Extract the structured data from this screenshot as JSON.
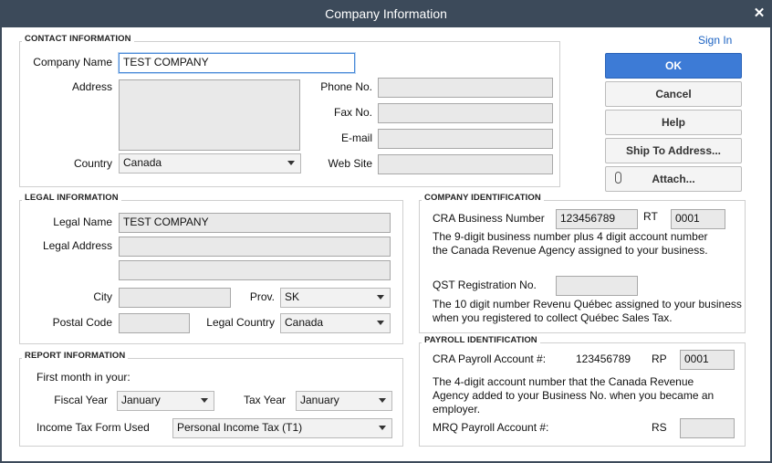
{
  "window": {
    "title": "Company Information",
    "close_glyph": "✕"
  },
  "signin": "Sign In",
  "buttons": {
    "ok": "OK",
    "cancel": "Cancel",
    "help": "Help",
    "ship_to": "Ship To Address...",
    "attach": "Attach..."
  },
  "contact": {
    "section_title": "CONTACT INFORMATION",
    "company_name_label": "Company Name",
    "company_name_value": "TEST COMPANY",
    "address_label": "Address",
    "address_value": "",
    "country_label": "Country",
    "country_value": "Canada",
    "phone_label": "Phone No.",
    "phone_value": "",
    "fax_label": "Fax No.",
    "fax_value": "",
    "email_label": "E-mail",
    "email_value": "",
    "web_label": "Web Site",
    "web_value": ""
  },
  "legal": {
    "section_title": "LEGAL INFORMATION",
    "name_label": "Legal Name",
    "name_value": "TEST COMPANY",
    "address_label": "Legal Address",
    "address_line1": "",
    "address_line2": "",
    "city_label": "City",
    "city_value": "",
    "prov_label": "Prov.",
    "prov_value": "SK",
    "postal_label": "Postal Code",
    "postal_value": "",
    "country_label": "Legal Country",
    "country_value": "Canada"
  },
  "report": {
    "section_title": "REPORT INFORMATION",
    "first_month_label": "First month in your:",
    "fiscal_label": "Fiscal Year",
    "fiscal_value": "January",
    "tax_label": "Tax Year",
    "tax_value": "January",
    "form_label": "Income Tax Form Used",
    "form_value": "Personal Income Tax (T1)"
  },
  "company_id": {
    "section_title": "COMPANY IDENTIFICATION",
    "cra_label": "CRA Business Number",
    "cra_value": "123456789",
    "rt_label": "RT",
    "rt_value": "0001",
    "cra_note_1": "The 9-digit business number plus 4 digit account number",
    "cra_note_2": "the Canada Revenue Agency assigned to your business.",
    "qst_label": "QST Registration No.",
    "qst_value": "",
    "qst_note_1": "The 10 digit number Revenu Québec assigned to your business",
    "qst_note_2": "when you registered to collect Québec Sales Tax."
  },
  "payroll": {
    "section_title": "PAYROLL IDENTIFICATION",
    "cra_label": "CRA Payroll Account #:",
    "cra_value": "123456789",
    "rp_label": "RP",
    "rp_value": "0001",
    "note_1": "The 4-digit account number that the Canada Revenue",
    "note_2": "Agency added to your Business No. when you became an",
    "note_3": "employer.",
    "mrq_label": "MRQ Payroll Account #:",
    "rs_label": "RS",
    "rs_value": ""
  }
}
